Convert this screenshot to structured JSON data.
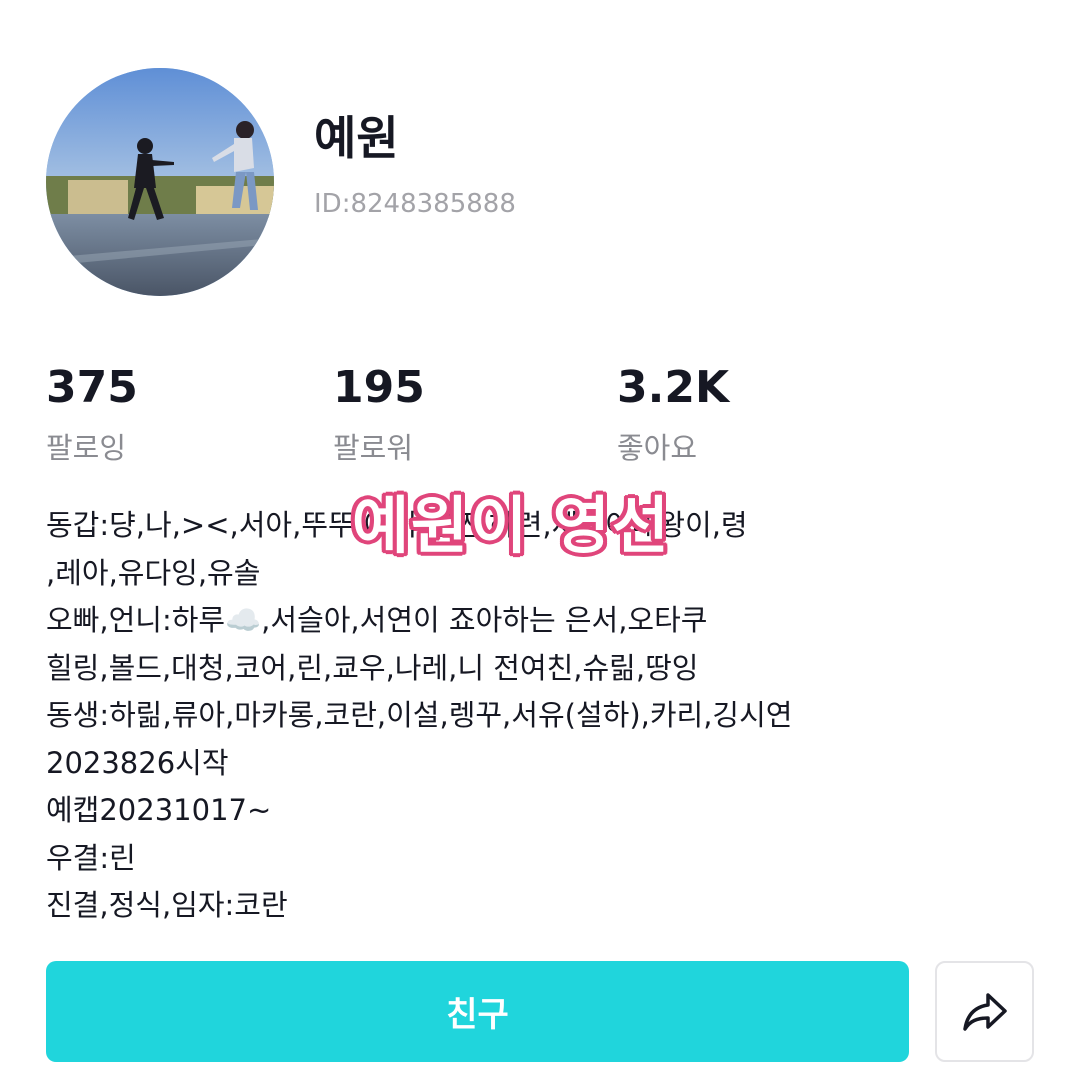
{
  "profile": {
    "name": "예원",
    "id": "ID:8248385888"
  },
  "stats": [
    {
      "value": "375",
      "label": "팔로잉"
    },
    {
      "value": "195",
      "label": "팔로워"
    },
    {
      "value": "3.2K",
      "label": "좋아요"
    }
  ],
  "bio": [
    "동갑:댱,나,><,서아,뚜뚜,에이,찐찐,하련,세종이대왕이,령",
    ",레아,유다잉,유솔",
    "오빠,언니:하루☁️,서슬아,서연이 죠아하는 은서,오타쿠",
    "힐링,볼드,대청,코어,린,쿄우,나레,니 전여친,슈릶,땅잉",
    "동생:하릶,류아,마카롱,코란,이설,렝꾸,서유(설하),카리,깅시연",
    "2023826시작",
    "예캡20231017~",
    "우결:린",
    "진결,정식,임자:코란"
  ],
  "overlay_text": "예원이 영선",
  "actions": {
    "friend_label": "친구",
    "share_icon": "share-arrow-icon"
  },
  "colors": {
    "accent": "#20d5dc",
    "overlay_outline": "#e0457b",
    "muted_text": "#8a8b91"
  }
}
